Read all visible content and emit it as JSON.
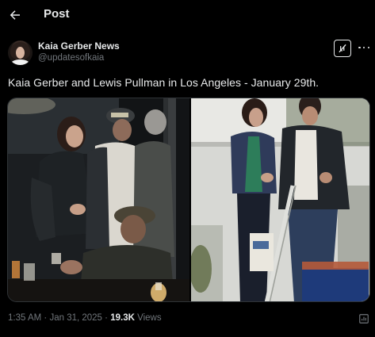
{
  "header": {
    "title": "Post",
    "back_icon": "arrow-left-icon"
  },
  "post": {
    "author": {
      "name": "Kaia Gerber News",
      "handle": "@updatesofkaia",
      "avatar_icon": "avatar"
    },
    "text": "Kaia Gerber and Lewis Pullman in Los Angeles - January 29th.",
    "media": {
      "count": 2
    },
    "meta": {
      "time": "1:35 AM",
      "separator": "·",
      "date": "Jan 31, 2025",
      "views_count": "19.3K",
      "views_label": "Views"
    }
  },
  "icons": {
    "grok": "grok-icon",
    "more": "more-icon",
    "stats": "stats-icon"
  },
  "colors": {
    "background": "#000000",
    "text_primary": "#e7e9ea",
    "text_secondary": "#71767b",
    "border": "#2f3336"
  }
}
